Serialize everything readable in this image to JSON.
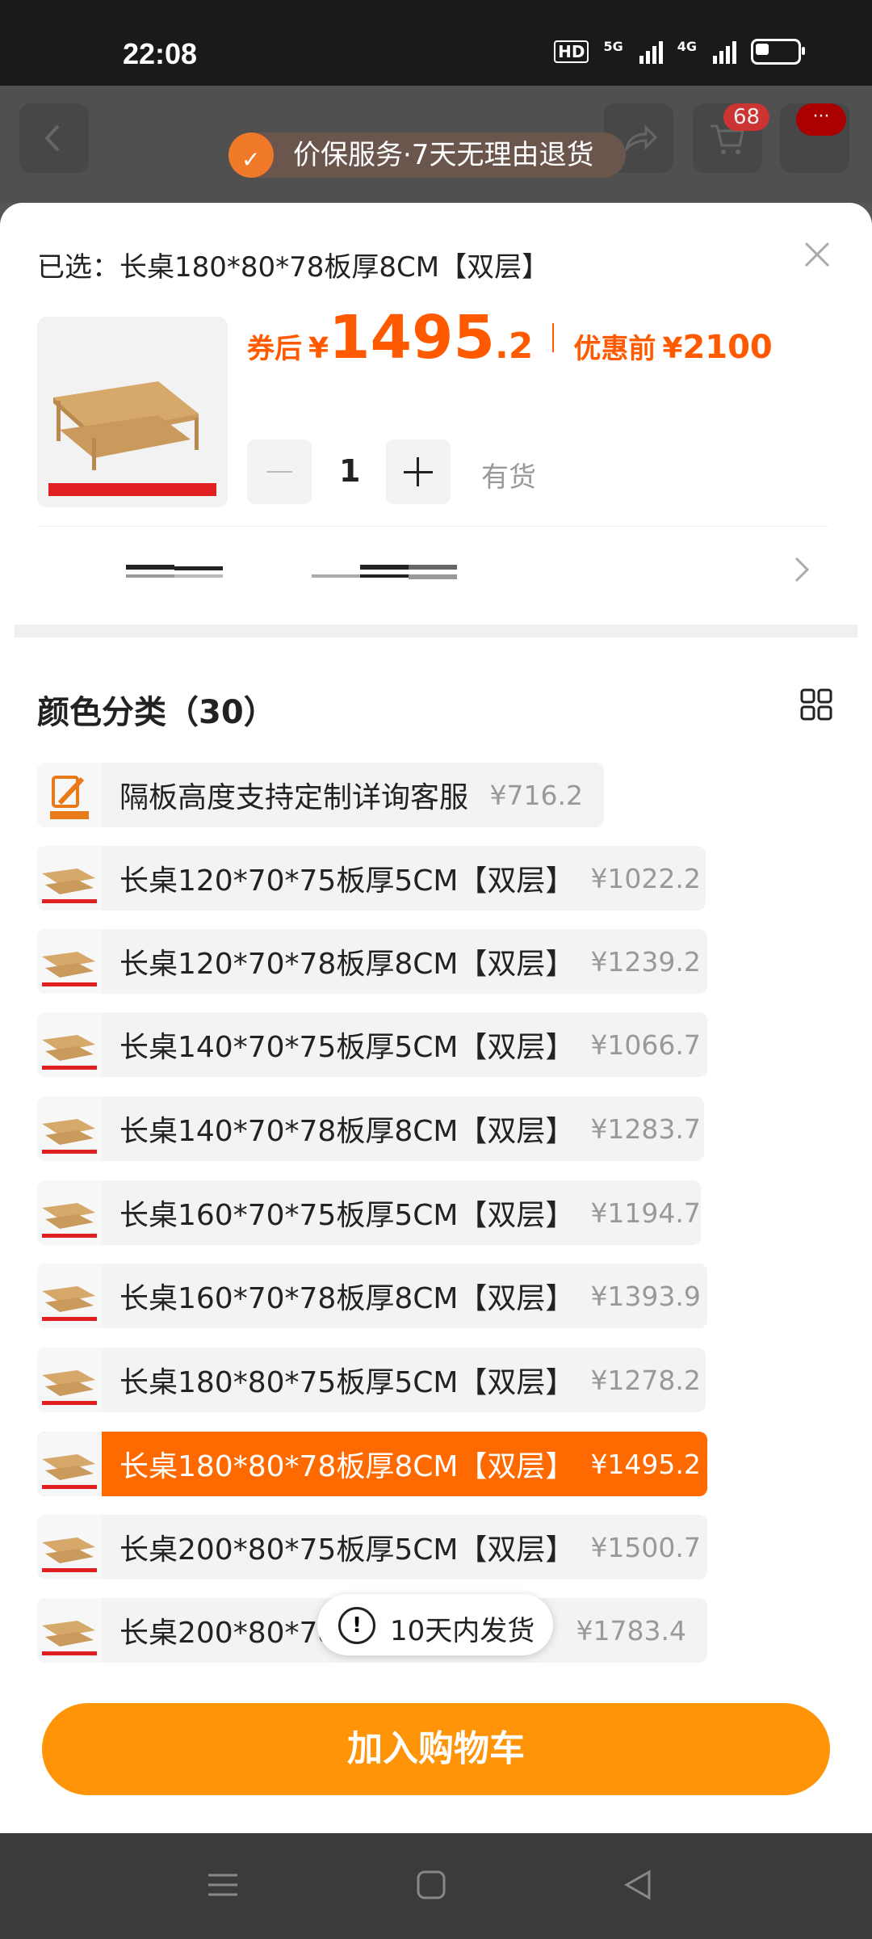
{
  "status_bar": {
    "time": "22:08",
    "hd": "HD",
    "net1": "5G",
    "net2": "4G"
  },
  "topbar": {
    "cart_count": "68",
    "more_badge": "···",
    "promo_text": "价保服务·7天无理由退货"
  },
  "sheet": {
    "selected_prefix": "已选：",
    "selected_value": "长桌180*80*78板厚8CM【双层】",
    "price": {
      "after_label": "券后",
      "yen": "¥",
      "int": "1495",
      "dec": ".2",
      "before_label": "优惠前",
      "before_value": "2100"
    },
    "quantity": "1",
    "stock": "有货",
    "category_title": "颜色分类（30）",
    "options": [
      {
        "label": "隔板高度支持定制详询客服",
        "price": "¥716.2"
      },
      {
        "label": "长桌120*70*75板厚5CM【双层】",
        "price": "¥1022.2"
      },
      {
        "label": "长桌120*70*78板厚8CM【双层】",
        "price": "¥1239.2"
      },
      {
        "label": "长桌140*70*75板厚5CM【双层】",
        "price": "¥1066.7"
      },
      {
        "label": "长桌140*70*78板厚8CM【双层】",
        "price": "¥1283.7"
      },
      {
        "label": "长桌160*70*75板厚5CM【双层】",
        "price": "¥1194.7"
      },
      {
        "label": "长桌160*70*78板厚8CM【双层】",
        "price": "¥1393.9"
      },
      {
        "label": "长桌180*80*75板厚5CM【双层】",
        "price": "¥1278.2"
      },
      {
        "label": "长桌180*80*78板厚8CM【双层】",
        "price": "¥1495.2"
      },
      {
        "label": "长桌200*80*75板厚5CM【双层】",
        "price": "¥1500.7"
      },
      {
        "label": "长桌200*80*78",
        "price": "¥1783.4"
      }
    ],
    "shipping_toast": "10天内发货",
    "add_to_cart": "加入购物车"
  },
  "colors": {
    "accent": "#ff6a00",
    "button": "#ff9408"
  }
}
